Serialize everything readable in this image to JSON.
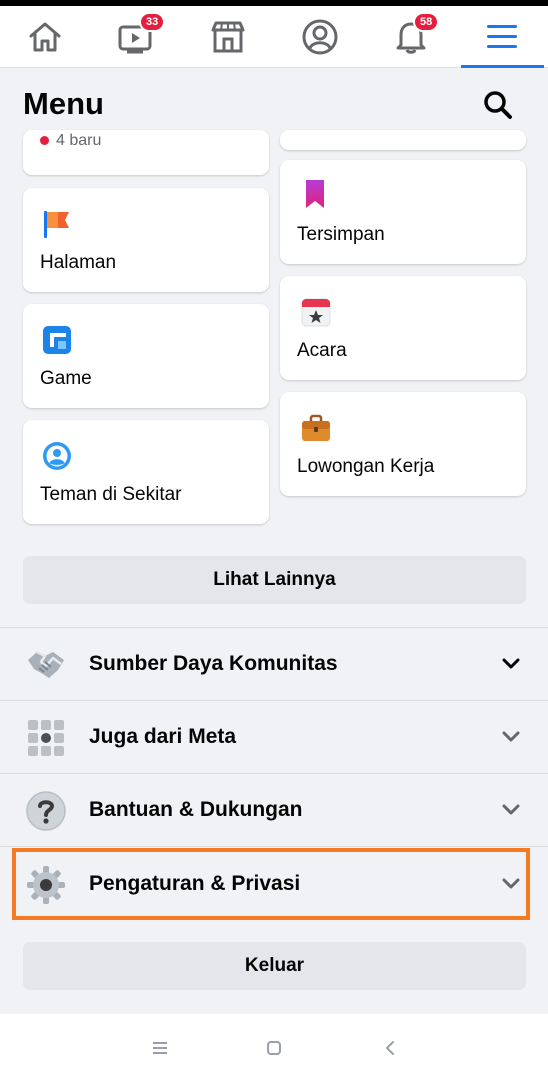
{
  "nav": {
    "items": [
      {
        "name": "home",
        "icon": "home-icon"
      },
      {
        "name": "watch",
        "icon": "video-icon",
        "badge": "33"
      },
      {
        "name": "marketplace",
        "icon": "store-icon"
      },
      {
        "name": "profile",
        "icon": "profile-icon"
      },
      {
        "name": "notifications",
        "icon": "bell-icon",
        "badge": "58"
      },
      {
        "name": "menu",
        "icon": "hamburger-menu-icon",
        "active": true
      }
    ],
    "accent_color": "#1877f2",
    "badge_color": "#e41e3f"
  },
  "header": {
    "title": "Menu"
  },
  "shortcuts": {
    "partial_card_text": "4 baru",
    "left": [
      {
        "label": "Halaman",
        "icon": "flag-icon"
      },
      {
        "label": "Game",
        "icon": "game-icon"
      },
      {
        "label": "Teman di Sekitar",
        "icon": "nearby-friends-icon"
      }
    ],
    "right": [
      {
        "label": "Tersimpan",
        "icon": "bookmark-icon"
      },
      {
        "label": "Acara",
        "icon": "calendar-star-icon"
      },
      {
        "label": "Lowongan Kerja",
        "icon": "briefcase-icon"
      }
    ],
    "see_more_label": "Lihat Lainnya"
  },
  "sections": [
    {
      "label": "Sumber Daya Komunitas",
      "icon": "handshake-icon"
    },
    {
      "label": "Juga dari Meta",
      "icon": "grid-apps-icon"
    },
    {
      "label": "Bantuan & Dukungan",
      "icon": "question-icon"
    },
    {
      "label": "Pengaturan & Privasi",
      "icon": "gear-icon",
      "highlighted": true
    }
  ],
  "highlight_color": "#f57a22",
  "logout_label": "Keluar"
}
